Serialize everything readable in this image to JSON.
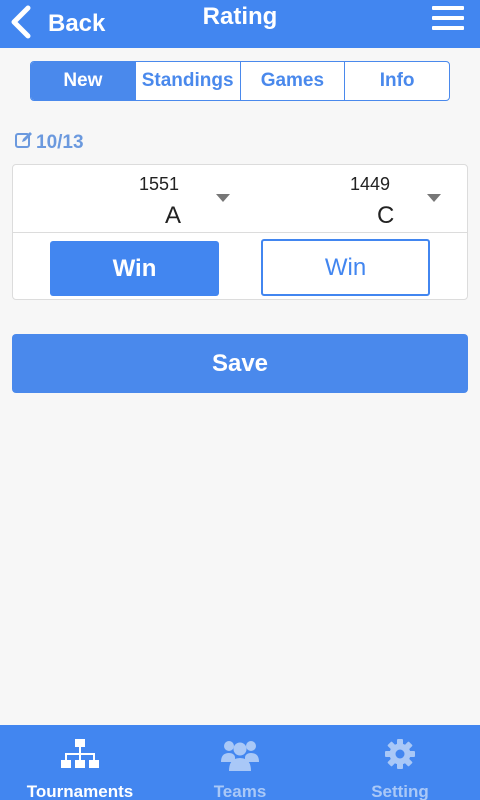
{
  "header": {
    "back_label": "Back",
    "title": "Rating",
    "back_icon": "chevron-left-icon",
    "menu_icon": "hamburger-menu-icon"
  },
  "tabs": [
    {
      "label": "New",
      "active": true
    },
    {
      "label": "Standings",
      "active": false
    },
    {
      "label": "Games",
      "active": false
    },
    {
      "label": "Info",
      "active": false
    }
  ],
  "round": {
    "icon": "edit-icon",
    "label": "10/13"
  },
  "match": {
    "left_player": {
      "rating": "1551",
      "name": "A"
    },
    "right_player": {
      "rating": "1449",
      "name": "C"
    },
    "left_win_label": "Win",
    "right_win_label": "Win",
    "selected": "left"
  },
  "save_label": "Save",
  "bottom_nav": [
    {
      "label": "Tournaments",
      "icon": "hierarchy-icon",
      "active": true
    },
    {
      "label": "Teams",
      "icon": "users-icon",
      "active": false
    },
    {
      "label": "Setting",
      "icon": "gear-icon",
      "active": false
    }
  ],
  "colors": {
    "primary": "#4286f0",
    "nav_inactive": "#a9c8f7",
    "background": "#f7f7f7"
  }
}
